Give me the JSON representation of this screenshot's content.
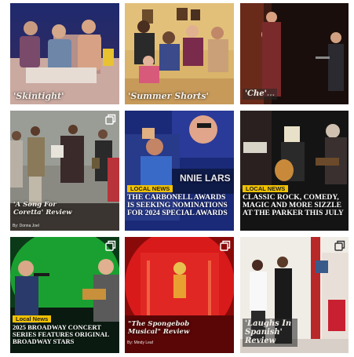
{
  "colors": {
    "badge_yellow": "#f2c200",
    "caption_text": "#f3f0ea"
  },
  "posts": [
    {
      "caption": "'Skintight'",
      "has_multi_icon": false
    },
    {
      "caption": "'Summer Shorts'",
      "has_multi_icon": false
    },
    {
      "caption": "'Che'",
      "caption_suffix": "...",
      "has_multi_icon": false
    },
    {
      "caption": "'A Song For Coretta' Review",
      "byline": "By: Donna Joel",
      "has_multi_icon": true,
      "icon": "multiple-images-icon"
    },
    {
      "badge": "LOCAL NEWS",
      "headline": "THE CARBONELL AWARDS IS SEEKING NOMINATIONS FOR 2024 SPECIAL AWARDS",
      "bg_text": "NNIE LARS",
      "has_multi_icon": false
    },
    {
      "badge": "LOCAL NEWS",
      "headline": "CLASSIC ROCK, COMEDY, MAGIC AND MORE SIZZLE AT THE PARKER THIS JULY",
      "has_multi_icon": false
    },
    {
      "badge": "Local News",
      "headline": "2025 BROADWAY CONCERT SERIES FEATURES ORIGINAL BROADWAY STARS",
      "has_multi_icon": true,
      "icon": "multiple-images-icon"
    },
    {
      "caption": "\"The Spongebob Musical\" Review",
      "byline": "By: Mindy Leaf",
      "has_multi_icon": true,
      "icon": "multiple-images-icon"
    },
    {
      "caption": "'Laughs In Spanish' Review",
      "has_multi_icon": true,
      "icon": "multiple-images-icon"
    }
  ]
}
